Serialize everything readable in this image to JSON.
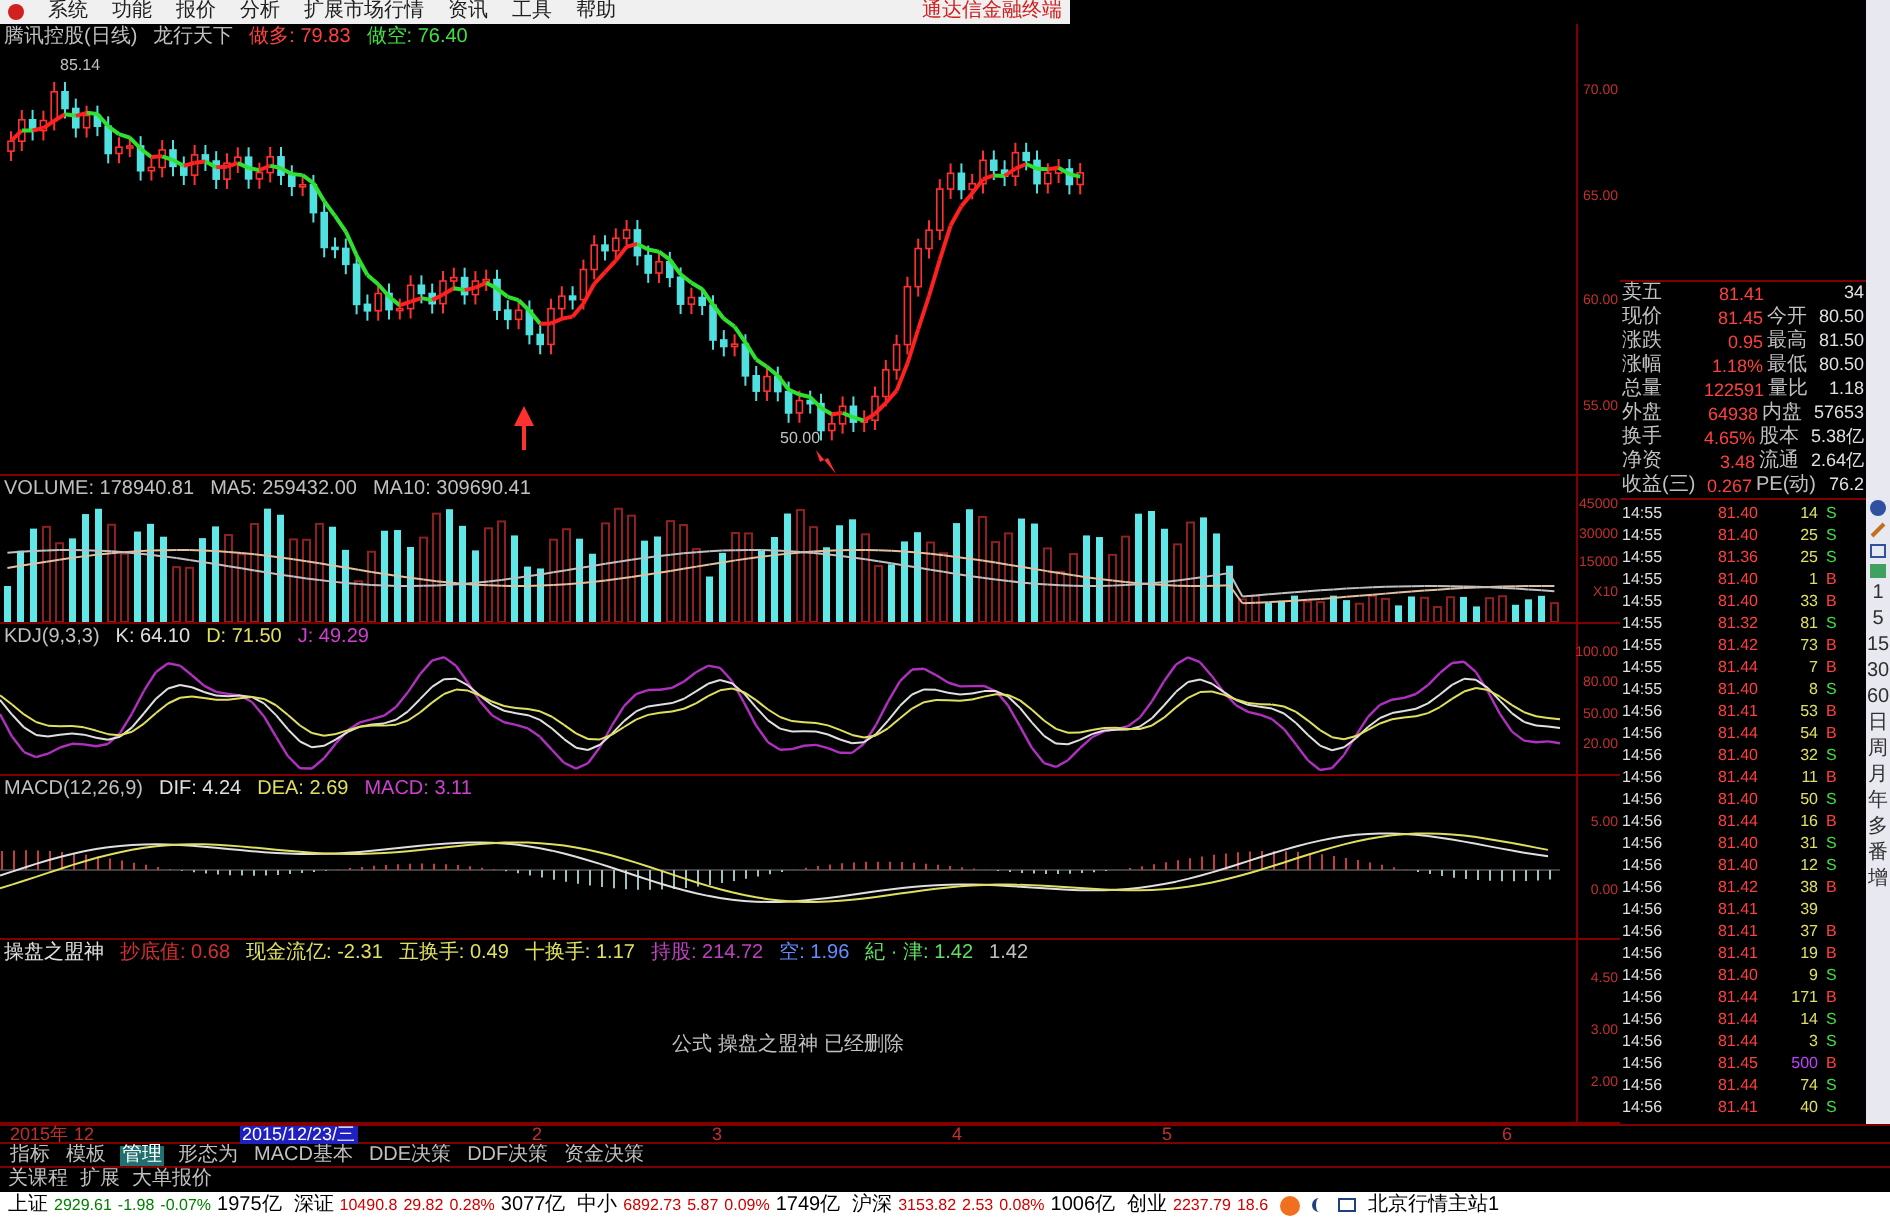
{
  "menu_bar": {
    "items": [
      "系统",
      "功能",
      "报价",
      "分析",
      "扩展市场行情",
      "资讯",
      "工具",
      "帮助"
    ],
    "brand": "通达信金融终端"
  },
  "price_panel": {
    "header": [
      {
        "text": "腾讯控股(日线)",
        "color": "#c0c0c0"
      },
      {
        "text": "龙行天下",
        "color": "#c0c0c0"
      },
      {
        "text": "做多: 79.83",
        "color": "#ff4040"
      },
      {
        "text": "做空: 76.40",
        "color": "#40e040"
      }
    ],
    "high_label": "85.14",
    "low_label": "50.00",
    "axis": [
      "70.00",
      "65.00",
      "60.00",
      "55.00"
    ]
  },
  "volume_panel": {
    "header": [
      {
        "text": "VOLUME: 178940.81",
        "color": "#c0c0c0"
      },
      {
        "text": "MA5: 259432.00",
        "color": "#c0c0c0"
      },
      {
        "text": "MA10: 309690.41",
        "color": "#c0c0c0"
      }
    ],
    "axis": [
      "45000",
      "30000",
      "15000",
      "X10"
    ]
  },
  "kdj_panel": {
    "header": [
      {
        "text": "KDJ(9,3,3)",
        "color": "#c0c0c0"
      },
      {
        "text": "K: 64.10",
        "color": "#e0e0e0"
      },
      {
        "text": "D: 71.50",
        "color": "#e0e060"
      },
      {
        "text": "J: 49.29",
        "color": "#d040d0"
      }
    ],
    "axis": [
      "100.00",
      "80.00",
      "50.00",
      "20.00"
    ]
  },
  "macd_panel": {
    "header": [
      {
        "text": "MACD(12,26,9)",
        "color": "#c0c0c0"
      },
      {
        "text": "DIF: 4.24",
        "color": "#e0e0e0"
      },
      {
        "text": "DEA: 2.69",
        "color": "#e0e060"
      },
      {
        "text": "MACD: 3.11",
        "color": "#d040d0"
      }
    ],
    "axis": [
      "5.00",
      "0.00"
    ]
  },
  "formula_panel": {
    "header": [
      {
        "text": "操盘之盟神",
        "color": "#e0e0e0"
      },
      {
        "text": "抄底值: 0.68",
        "color": "#d03030"
      },
      {
        "text": "现金流亿: -2.31",
        "color": "#e0e060"
      },
      {
        "text": "五换手: 0.49",
        "color": "#e0e060"
      },
      {
        "text": "十换手: 1.17",
        "color": "#e0e060"
      },
      {
        "text": "持股: 214.72",
        "color": "#c040c0"
      },
      {
        "text": "空: 1.96",
        "color": "#6090ff"
      },
      {
        "text": "紀 · 津: 1.42",
        "color": "#60e060"
      },
      {
        "text": "1.42",
        "color": "#c0c0c0"
      }
    ],
    "message": "公式 操盘之盟神 已经删除",
    "axis": [
      "4.50",
      "3.00",
      "2.00"
    ]
  },
  "date_axis": [
    {
      "text": "2015年",
      "selected": false
    },
    {
      "text": "12",
      "selected": false
    },
    {
      "text": "2015/12/23/三",
      "selected": true
    },
    {
      "text": "2",
      "selected": false
    },
    {
      "text": "3",
      "selected": false
    },
    {
      "text": "4",
      "selected": false
    },
    {
      "text": "5",
      "selected": false
    },
    {
      "text": "6",
      "selected": false
    }
  ],
  "tabs": [
    {
      "label": "指标",
      "selected": false
    },
    {
      "label": "模板",
      "selected": false
    },
    {
      "label": "管理",
      "selected": true
    },
    {
      "label": "形态为",
      "selected": false
    },
    {
      "label": "MACD基本",
      "selected": false
    },
    {
      "label": "DDE决策",
      "selected": false
    },
    {
      "label": "DDF决策",
      "selected": false
    },
    {
      "label": "资金决策",
      "selected": false
    }
  ],
  "sub_tabs": [
    "关课程",
    "扩展",
    "大单报价"
  ],
  "quote": [
    {
      "label": "卖五",
      "value": "81.41",
      "value2": "34"
    },
    {
      "label": "现价",
      "value": "81.45",
      "label2": "今开",
      "value2": "80.50"
    },
    {
      "label": "涨跌",
      "value": "0.95",
      "label2": "最高",
      "value2": "81.50"
    },
    {
      "label": "涨幅",
      "value": "1.18%",
      "label2": "最低",
      "value2": "80.50"
    },
    {
      "label": "总量",
      "value": "122591",
      "label2": "量比",
      "value2": "1.18"
    },
    {
      "label": "外盘",
      "value": "64938",
      "label2": "内盘",
      "value2": "57653"
    },
    {
      "label": "换手",
      "value": "4.65%",
      "label2": "股本",
      "value2": "5.38亿"
    },
    {
      "label": "净资",
      "value": "3.48",
      "label2": "流通",
      "value2": "2.64亿"
    },
    {
      "label": "收益(三)",
      "value": "0.267",
      "label2": "PE(动)",
      "value2": "76.2"
    }
  ],
  "trades": [
    {
      "time": "14:55",
      "price": "81.40",
      "volume": "14",
      "side": "S",
      "large": false
    },
    {
      "time": "14:55",
      "price": "81.40",
      "volume": "25",
      "side": "S",
      "large": false
    },
    {
      "time": "14:55",
      "price": "81.36",
      "volume": "25",
      "side": "S",
      "large": false
    },
    {
      "time": "14:55",
      "price": "81.40",
      "volume": "1",
      "side": "B",
      "large": false
    },
    {
      "time": "14:55",
      "price": "81.40",
      "volume": "33",
      "side": "B",
      "large": false
    },
    {
      "time": "14:55",
      "price": "81.32",
      "volume": "81",
      "side": "S",
      "large": false
    },
    {
      "time": "14:55",
      "price": "81.42",
      "volume": "73",
      "side": "B",
      "large": false
    },
    {
      "time": "14:55",
      "price": "81.44",
      "volume": "7",
      "side": "B",
      "large": false
    },
    {
      "time": "14:55",
      "price": "81.40",
      "volume": "8",
      "side": "S",
      "large": false
    },
    {
      "time": "14:56",
      "price": "81.41",
      "volume": "53",
      "side": "B",
      "large": false
    },
    {
      "time": "14:56",
      "price": "81.44",
      "volume": "54",
      "side": "B",
      "large": false
    },
    {
      "time": "14:56",
      "price": "81.40",
      "volume": "32",
      "side": "S",
      "large": false
    },
    {
      "time": "14:56",
      "price": "81.44",
      "volume": "11",
      "side": "B",
      "large": false
    },
    {
      "time": "14:56",
      "price": "81.40",
      "volume": "50",
      "side": "S",
      "large": false
    },
    {
      "time": "14:56",
      "price": "81.44",
      "volume": "16",
      "side": "B",
      "large": false
    },
    {
      "time": "14:56",
      "price": "81.40",
      "volume": "31",
      "side": "S",
      "large": false
    },
    {
      "time": "14:56",
      "price": "81.40",
      "volume": "12",
      "side": "S",
      "large": false
    },
    {
      "time": "14:56",
      "price": "81.42",
      "volume": "38",
      "side": "B",
      "large": false
    },
    {
      "time": "14:56",
      "price": "81.41",
      "volume": "39",
      "large": false
    },
    {
      "time": "14:56",
      "price": "81.41",
      "volume": "37",
      "side": "B",
      "large": false
    },
    {
      "time": "14:56",
      "price": "81.41",
      "volume": "19",
      "side": "B",
      "large": false
    },
    {
      "time": "14:56",
      "price": "81.40",
      "volume": "9",
      "side": "S",
      "large": false
    },
    {
      "time": "14:56",
      "price": "81.44",
      "volume": "171",
      "side": "B",
      "large": false
    },
    {
      "time": "14:56",
      "price": "81.44",
      "volume": "14",
      "side": "S",
      "large": false
    },
    {
      "time": "14:56",
      "price": "81.44",
      "volume": "3",
      "side": "S",
      "large": false
    },
    {
      "time": "14:56",
      "price": "81.45",
      "volume": "500",
      "side": "B",
      "large": true
    },
    {
      "time": "14:56",
      "price": "81.44",
      "volume": "74",
      "side": "S",
      "large": false
    },
    {
      "time": "14:56",
      "price": "81.41",
      "volume": "40",
      "side": "S",
      "large": false
    }
  ],
  "side_toolbar": [
    "1",
    "5",
    "15",
    "30",
    "60",
    "日",
    "周",
    "月",
    "年",
    "多",
    "番",
    "增"
  ],
  "status_bar": {
    "indices": [
      {
        "name": "上证",
        "value": "2929.61",
        "change": "-1.98",
        "pct": "-0.07%",
        "amount": "1975亿",
        "falling": true
      },
      {
        "name": "深证",
        "value": "10490.8",
        "change": "29.82",
        "pct": "0.28%",
        "amount": "3077亿",
        "falling": false
      },
      {
        "name": "中小",
        "value": "6892.73",
        "change": "5.87",
        "pct": "0.09%",
        "amount": "1749亿",
        "falling": false
      },
      {
        "name": "沪深",
        "value": "3153.82",
        "change": "2.53",
        "pct": "0.08%",
        "amount": "1006亿",
        "falling": false
      },
      {
        "name": "创业",
        "value": "2237.79",
        "change": "18.6",
        "falling": false
      }
    ],
    "server": "北京行情主站1"
  }
}
